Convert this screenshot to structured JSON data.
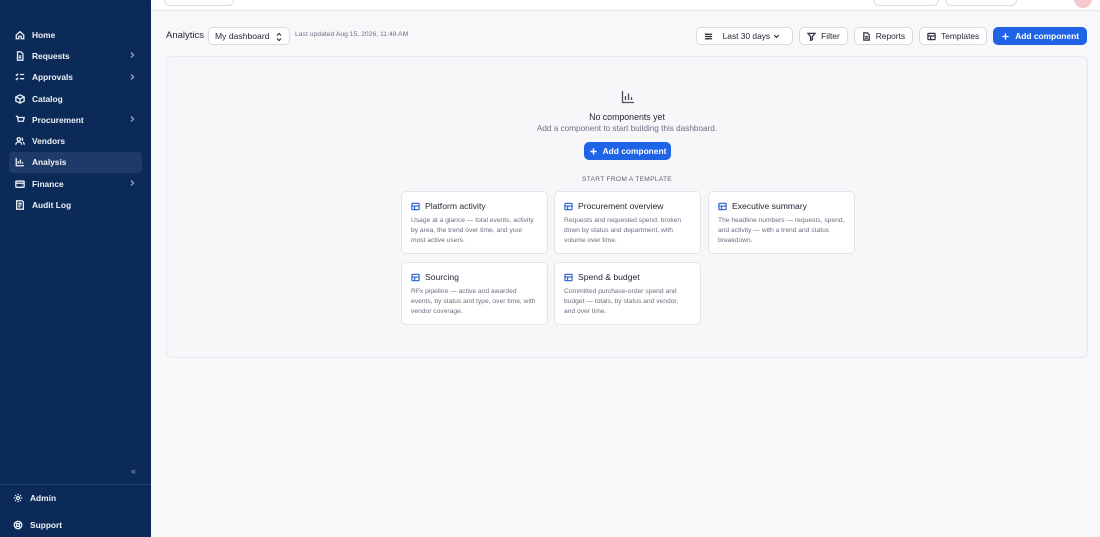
{
  "sidebar": {
    "items": [
      {
        "label": "Home",
        "icon": "home-icon",
        "chevron": false,
        "active": false
      },
      {
        "label": "Requests",
        "icon": "file-icon",
        "chevron": true,
        "active": false
      },
      {
        "label": "Approvals",
        "icon": "checklist-icon",
        "chevron": true,
        "active": false
      },
      {
        "label": "Catalog",
        "icon": "box-icon",
        "chevron": false,
        "active": false
      },
      {
        "label": "Procurement",
        "icon": "cart-icon",
        "chevron": true,
        "active": false
      },
      {
        "label": "Vendors",
        "icon": "users-icon",
        "chevron": false,
        "active": false
      },
      {
        "label": "Analysis",
        "icon": "bar-chart-icon",
        "chevron": false,
        "active": true
      },
      {
        "label": "Finance",
        "icon": "wallet-icon",
        "chevron": true,
        "active": false
      },
      {
        "label": "Audit Log",
        "icon": "log-icon",
        "chevron": false,
        "active": false
      }
    ],
    "collapse_glyph": "«",
    "admin_label": "Admin",
    "support_label": "Support"
  },
  "toolbar": {
    "section": "Analytics",
    "dashboard": "My dashboard",
    "updated": "Last updated Aug 15, 2026, 11:48 AM",
    "range": "Last 30 days",
    "filter": "Filter",
    "reports": "Reports",
    "templates": "Templates",
    "add_component": "Add component"
  },
  "empty_state": {
    "title": "No components yet",
    "subtitle": "Add a component to start building this dashboard.",
    "button": "Add component",
    "templates_heading": "START FROM A TEMPLATE"
  },
  "templates": [
    {
      "title": "Platform activity",
      "desc": "Usage at a glance — total events, activity by area, the trend over time, and your most active users."
    },
    {
      "title": "Procurement overview",
      "desc": "Requests and requested spend, broken down by status and department, with volume over time."
    },
    {
      "title": "Executive summary",
      "desc": "The headline numbers — requests, spend, and activity — with a trend and status breakdown."
    },
    {
      "title": "Sourcing",
      "desc": "RFx pipeline — active and awarded events, by status and type, over time, with vendor coverage."
    },
    {
      "title": "Spend & budget",
      "desc": "Committed purchase-order spend and budget — totals, by status and vendor, and over time."
    }
  ],
  "colors": {
    "sidebar": "#0c2a57",
    "accent": "#1f63e6"
  }
}
